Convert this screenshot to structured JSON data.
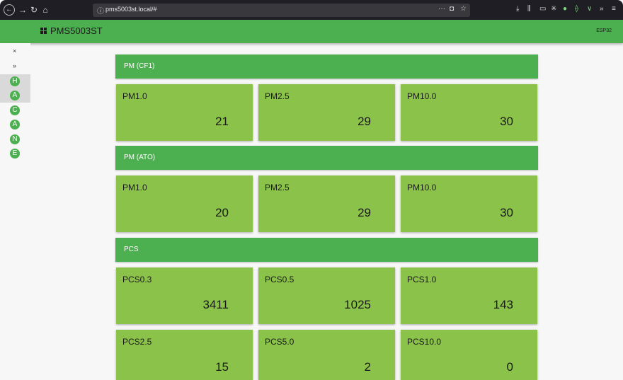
{
  "browser": {
    "url": "pms5003st.local/#",
    "reader_icon": "reader-icon",
    "bookmark_icon": "star-icon"
  },
  "app": {
    "title": "PMS5003ST",
    "device": "ESP32"
  },
  "sidebar": {
    "close": "×",
    "expand": "»",
    "items": [
      "H",
      "A",
      "C",
      "A",
      "N",
      "E"
    ]
  },
  "sections": [
    {
      "title": "PM (CF1)",
      "cards": [
        {
          "label": "PM1.0",
          "value": "21"
        },
        {
          "label": "PM2.5",
          "value": "29"
        },
        {
          "label": "PM10.0",
          "value": "30"
        }
      ]
    },
    {
      "title": "PM (ATO)",
      "cards": [
        {
          "label": "PM1.0",
          "value": "20"
        },
        {
          "label": "PM2.5",
          "value": "29"
        },
        {
          "label": "PM10.0",
          "value": "30"
        }
      ]
    },
    {
      "title": "PCS",
      "cards": [
        {
          "label": "PCS0.3",
          "value": "3411"
        },
        {
          "label": "PCS0.5",
          "value": "1025"
        },
        {
          "label": "PCS1.0",
          "value": "143"
        },
        {
          "label": "PCS2.5",
          "value": "15"
        },
        {
          "label": "PCS5.0",
          "value": "2"
        },
        {
          "label": "PCS10.0",
          "value": "0"
        }
      ]
    }
  ],
  "colors": {
    "header": "#4caf50",
    "card": "#8bc34a"
  }
}
